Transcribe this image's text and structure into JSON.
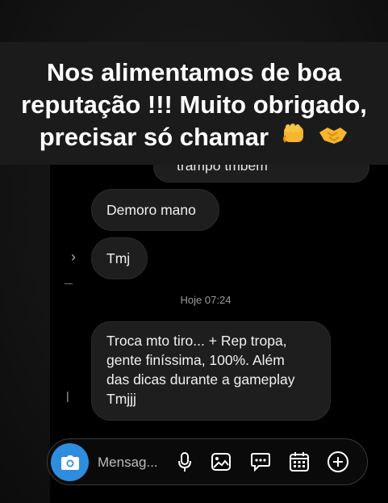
{
  "caption": {
    "lines": [
      "Nos alimentamos de boa",
      "reputação !!! Muito obrigado,",
      "precisar só chamar"
    ],
    "emojis": [
      "fist-icon",
      "handshake-icon"
    ]
  },
  "messages": [
    {
      "text": "trampo tmbem",
      "partial": true
    },
    {
      "text": "Demoro mano"
    },
    {
      "text": "Tmj"
    },
    {
      "text": "Troca mto tiro... + Rep tropa,\ngente finíssima, 100%. Além\ndas dicas durante a gameplay\nTmjjj"
    }
  ],
  "timestamp": "Hoje 07:24",
  "composer": {
    "placeholder": "Mensag...",
    "icons": [
      "camera-icon",
      "microphone-icon",
      "image-icon",
      "sticker-icon",
      "calendar-icon",
      "plus-icon"
    ]
  },
  "colors": {
    "accent": "#2f8de0",
    "caption_bg": "#1b1b1b",
    "bubble_bg": "#1e1e1e"
  }
}
